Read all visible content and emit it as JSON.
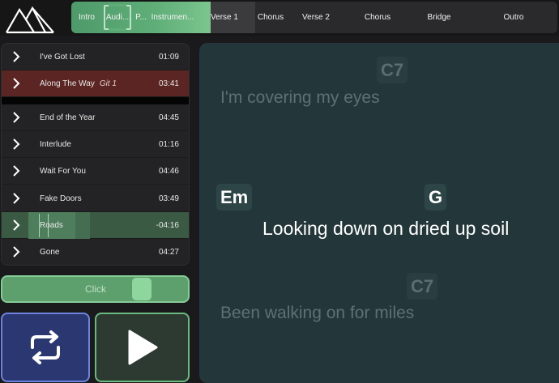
{
  "sections": [
    {
      "label": "Intro"
    },
    {
      "label": "Audi..."
    },
    {
      "label": "P..."
    },
    {
      "label": "Instrumen..."
    },
    {
      "label": "Verse 1"
    },
    {
      "label": "Chorus"
    },
    {
      "label": "Verse 2"
    },
    {
      "label": "Chorus"
    },
    {
      "label": "Bridge"
    },
    {
      "label": "Outro"
    }
  ],
  "setlist": [
    {
      "title": "I've Got Lost",
      "duration": "01:09"
    },
    {
      "title": "Along The Way",
      "tag": "Git 1",
      "duration": "03:41"
    },
    {
      "title": "End of the Year",
      "duration": "04:45"
    },
    {
      "title": "Interlude",
      "duration": "01:16"
    },
    {
      "title": "Wait For You",
      "duration": "04:46"
    },
    {
      "title": "Fake Doors",
      "duration": "03:49"
    },
    {
      "title": "Roads",
      "duration": "-04:16"
    },
    {
      "title": "Gone",
      "duration": "04:27"
    }
  ],
  "click": {
    "label": "Click",
    "level": 0.78
  },
  "lyrics": {
    "previous": {
      "chord": "C7",
      "text": "I'm covering my eyes"
    },
    "current": {
      "chord1": "Em",
      "chord2": "G",
      "text": "Looking down on dried up soil"
    },
    "next": {
      "chord": "C7",
      "text": "Been walking on for miles"
    }
  },
  "colors": {
    "accent_green": "#5fae78",
    "active_song": "#5a2522",
    "loop_blue": "#6d83e0",
    "lyrics_bg": "#23373a"
  },
  "icons": {
    "logo": "mountain-logo-icon",
    "chevron": "chevron-right-icon",
    "loop": "loop-icon",
    "play": "play-icon"
  }
}
